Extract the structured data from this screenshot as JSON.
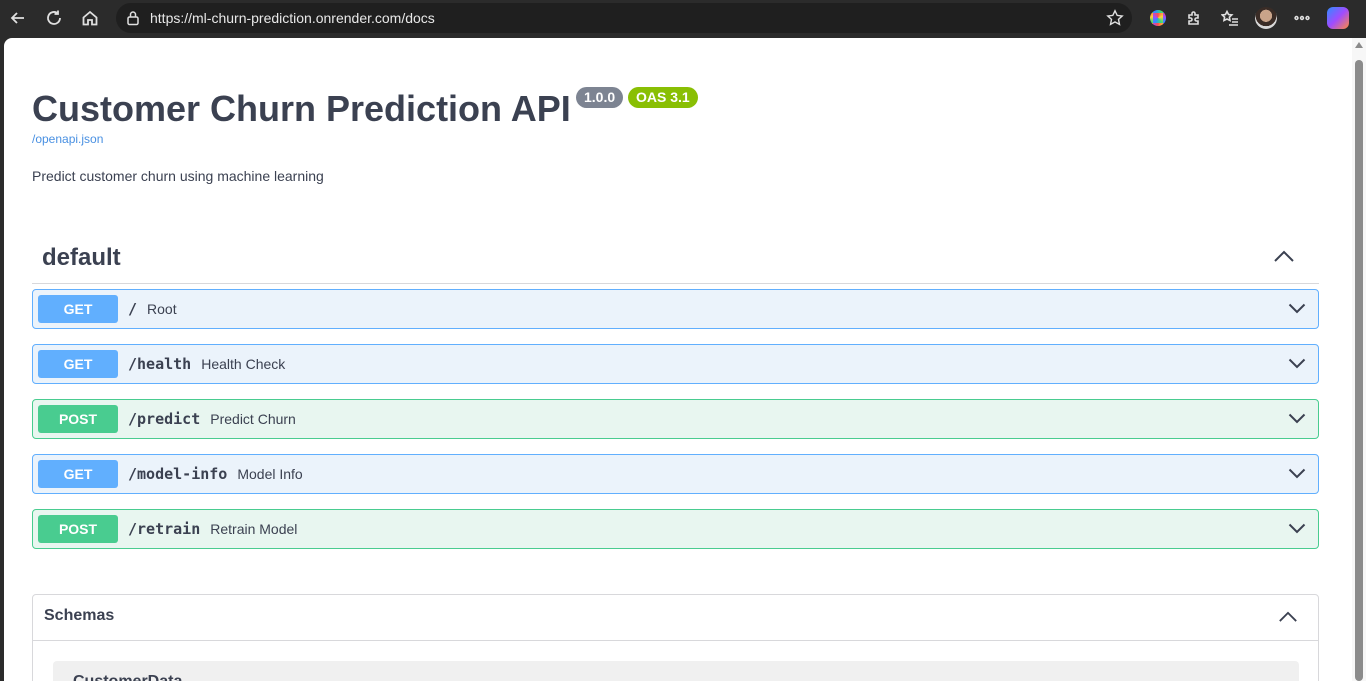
{
  "browser": {
    "url": "https://ml-churn-prediction.onrender.com/docs"
  },
  "page": {
    "title": "Customer Churn Prediction API",
    "version_badge": "1.0.0",
    "oas_badge": "OAS 3.1",
    "openapi_link": "/openapi.json",
    "description": "Predict customer churn using machine learning"
  },
  "section": {
    "title": "default"
  },
  "operations": [
    {
      "method": "GET",
      "path": "/",
      "summary": "Root"
    },
    {
      "method": "GET",
      "path": "/health",
      "summary": "Health Check"
    },
    {
      "method": "POST",
      "path": "/predict",
      "summary": "Predict Churn"
    },
    {
      "method": "GET",
      "path": "/model-info",
      "summary": "Model Info"
    },
    {
      "method": "POST",
      "path": "/retrain",
      "summary": "Retrain Model"
    }
  ],
  "schemas": {
    "title": "Schemas",
    "items": [
      "CustomerData"
    ]
  },
  "colors": {
    "get": "#61affe",
    "post": "#49cc90",
    "text": "#3b4151",
    "link": "#4990e2"
  }
}
